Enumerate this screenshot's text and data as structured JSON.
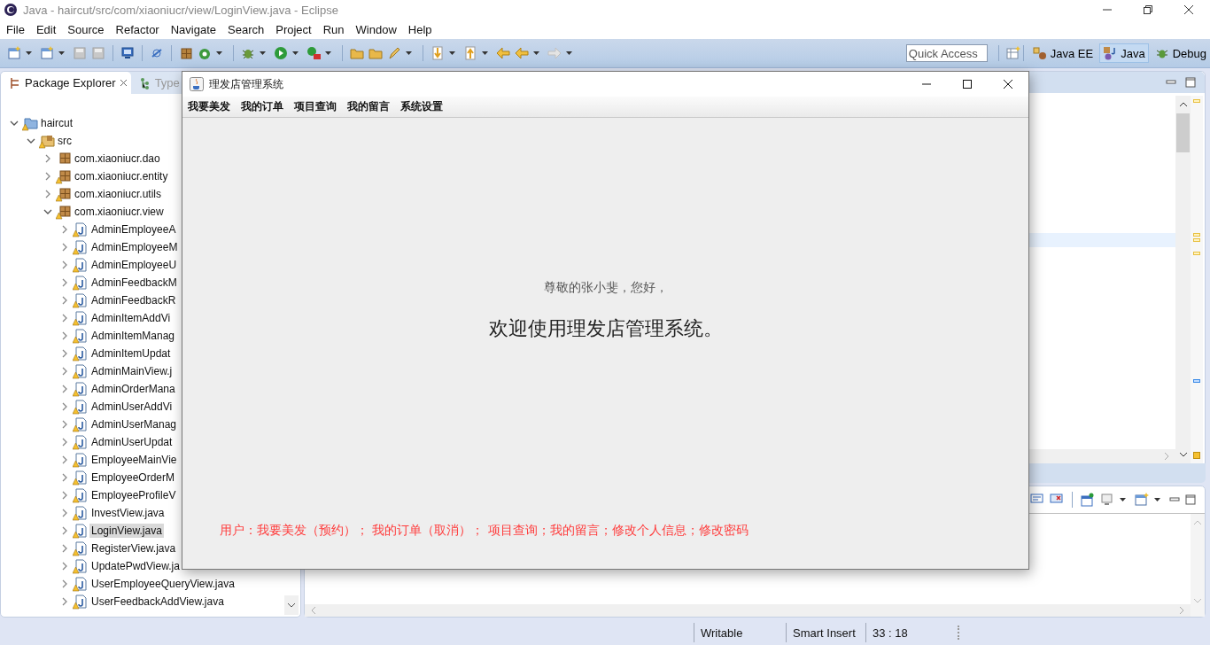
{
  "window": {
    "title": "Java - haircut/src/com/xiaoniucr/view/LoginView.java - Eclipse"
  },
  "menu": [
    "File",
    "Edit",
    "Source",
    "Refactor",
    "Navigate",
    "Search",
    "Project",
    "Run",
    "Window",
    "Help"
  ],
  "quick_access": {
    "placeholder": "Quick Access"
  },
  "perspectives": [
    {
      "label": "Java EE",
      "selected": false
    },
    {
      "label": "Java",
      "selected": true
    },
    {
      "label": "Debug",
      "selected": false
    }
  ],
  "left_tabs": [
    {
      "label": "Package Explorer",
      "selected": true
    },
    {
      "label": "Type",
      "selected": false
    }
  ],
  "tree": [
    {
      "label": "haircut",
      "kind": "project",
      "expanded": true,
      "selected": false,
      "warning": true,
      "children": [
        {
          "label": "src",
          "kind": "folder",
          "expanded": true,
          "selected": false,
          "warning": true,
          "children": [
            {
              "label": "com.xiaoniucr.dao",
              "kind": "package",
              "expanded": false,
              "selected": false,
              "warning": false
            },
            {
              "label": "com.xiaoniucr.entity",
              "kind": "package",
              "expanded": false,
              "selected": false,
              "warning": true
            },
            {
              "label": "com.xiaoniucr.utils",
              "kind": "package",
              "expanded": false,
              "selected": false,
              "warning": true
            },
            {
              "label": "com.xiaoniucr.view",
              "kind": "package",
              "expanded": true,
              "selected": false,
              "warning": true,
              "children": [
                {
                  "label": "AdminEmployeeA",
                  "kind": "file",
                  "expanded": false,
                  "selected": false,
                  "warning": true
                },
                {
                  "label": "AdminEmployeeM",
                  "kind": "file",
                  "expanded": false,
                  "selected": false,
                  "warning": true
                },
                {
                  "label": "AdminEmployeeU",
                  "kind": "file",
                  "expanded": false,
                  "selected": false,
                  "warning": true
                },
                {
                  "label": "AdminFeedbackM",
                  "kind": "file",
                  "expanded": false,
                  "selected": false,
                  "warning": true
                },
                {
                  "label": "AdminFeedbackR",
                  "kind": "file",
                  "expanded": false,
                  "selected": false,
                  "warning": true
                },
                {
                  "label": "AdminItemAddVi",
                  "kind": "file",
                  "expanded": false,
                  "selected": false,
                  "warning": true
                },
                {
                  "label": "AdminItemManag",
                  "kind": "file",
                  "expanded": false,
                  "selected": false,
                  "warning": true
                },
                {
                  "label": "AdminItemUpdat",
                  "kind": "file",
                  "expanded": false,
                  "selected": false,
                  "warning": true
                },
                {
                  "label": "AdminMainView.j",
                  "kind": "file",
                  "expanded": false,
                  "selected": false,
                  "warning": true
                },
                {
                  "label": "AdminOrderMana",
                  "kind": "file",
                  "expanded": false,
                  "selected": false,
                  "warning": true
                },
                {
                  "label": "AdminUserAddVi",
                  "kind": "file",
                  "expanded": false,
                  "selected": false,
                  "warning": true
                },
                {
                  "label": "AdminUserManag",
                  "kind": "file",
                  "expanded": false,
                  "selected": false,
                  "warning": true
                },
                {
                  "label": "AdminUserUpdat",
                  "kind": "file",
                  "expanded": false,
                  "selected": false,
                  "warning": true
                },
                {
                  "label": "EmployeeMainVie",
                  "kind": "file",
                  "expanded": false,
                  "selected": false,
                  "warning": true
                },
                {
                  "label": "EmployeeOrderM",
                  "kind": "file",
                  "expanded": false,
                  "selected": false,
                  "warning": true
                },
                {
                  "label": "EmployeeProfileV",
                  "kind": "file",
                  "expanded": false,
                  "selected": false,
                  "warning": true
                },
                {
                  "label": "InvestView.java",
                  "kind": "file",
                  "expanded": false,
                  "selected": false,
                  "warning": true
                },
                {
                  "label": "LoginView.java",
                  "kind": "file",
                  "expanded": false,
                  "selected": true,
                  "warning": true
                },
                {
                  "label": "RegisterView.java",
                  "kind": "file",
                  "expanded": false,
                  "selected": false,
                  "warning": true
                },
                {
                  "label": "UpdatePwdView.ja",
                  "kind": "file",
                  "expanded": false,
                  "selected": false,
                  "warning": true
                },
                {
                  "label": "UserEmployeeQueryView.java",
                  "kind": "file",
                  "expanded": false,
                  "selected": false,
                  "warning": true
                },
                {
                  "label": "UserFeedbackAddView.java",
                  "kind": "file",
                  "expanded": false,
                  "selected": false,
                  "warning": true
                }
              ]
            }
          ]
        }
      ]
    }
  ],
  "dialog": {
    "title": "理发店管理系统",
    "menu": [
      "我要美发",
      "我的订单",
      "项目查询",
      "我的留言",
      "系统设置"
    ],
    "greeting": "尊敬的张小斐，您好，",
    "welcome": "欢迎使用理发店管理系统。",
    "note": "用户：我要美发（预约）； 我的订单（取消）； 项目查询；我的留言；修改个人信息；修改密码"
  },
  "status_bar": [
    "Writable",
    "Smart Insert",
    "33 : 18"
  ]
}
